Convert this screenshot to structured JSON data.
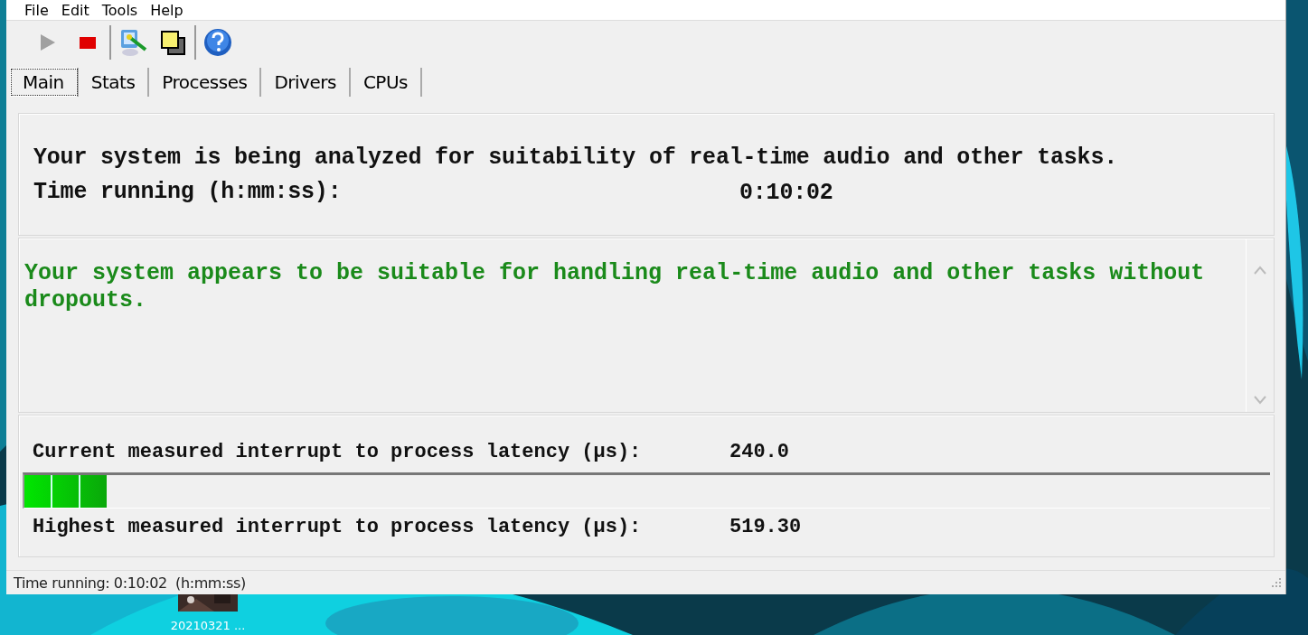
{
  "menu": [
    {
      "label": "File"
    },
    {
      "label": "Edit"
    },
    {
      "label": "Tools"
    },
    {
      "label": "Help"
    }
  ],
  "toolbar": [
    {
      "kind": "play",
      "disabled": true
    },
    {
      "kind": "stop",
      "disabled": false
    },
    {
      "kind": "separator"
    },
    {
      "kind": "computer",
      "disabled": false
    },
    {
      "kind": "windows",
      "disabled": false
    },
    {
      "kind": "separator"
    },
    {
      "kind": "help",
      "disabled": false
    }
  ],
  "tabs": [
    {
      "label": "Main",
      "selected": true
    },
    {
      "label": "Stats",
      "selected": false
    },
    {
      "label": "Processes",
      "selected": false
    },
    {
      "label": "Drivers",
      "selected": false
    },
    {
      "label": "CPUs",
      "selected": false
    }
  ],
  "analysis": {
    "message": "Your system is being analyzed for suitability of real-time audio and other tasks.",
    "time_label": "Time running (h:mm:ss):",
    "time_value": "0:10:02"
  },
  "verdict": {
    "text": "Your system appears to be suitable for handling real-time audio and other tasks without dropouts."
  },
  "latency": {
    "current_label": "Current measured interrupt to process latency (µs):",
    "current_value": "240.0",
    "level": 0.066,
    "highest_label": "Highest measured interrupt to process latency (µs):",
    "highest_value": "519.30"
  },
  "status_bar": "Time running: 0:10:02  (h:mm:ss)",
  "desktop_icons": [
    {
      "label": "20210321 ..."
    }
  ]
}
